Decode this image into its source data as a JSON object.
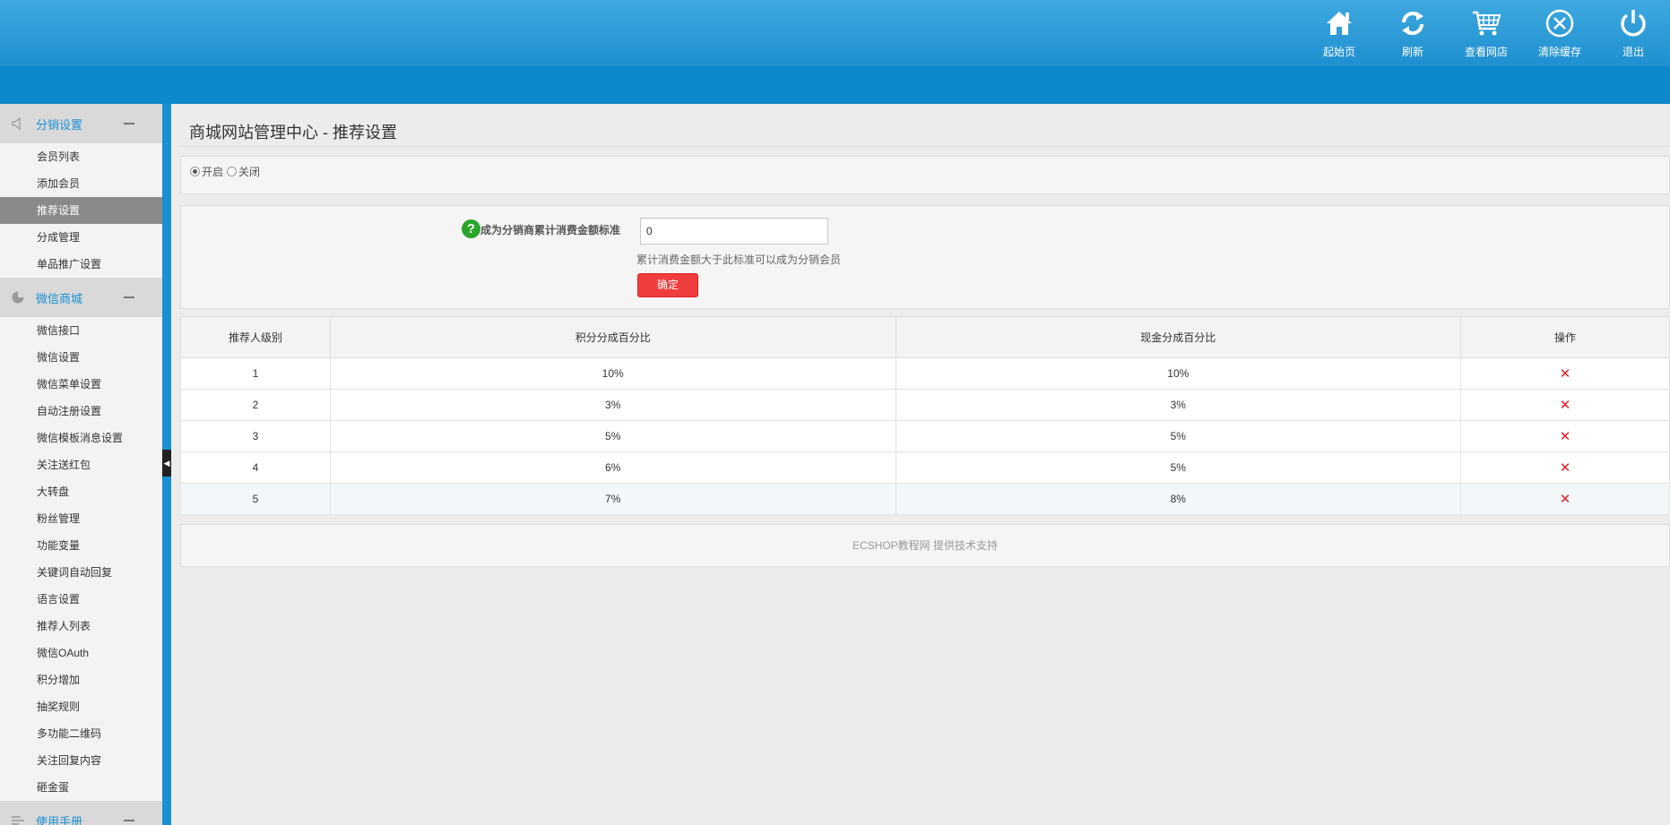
{
  "header": {
    "nav": [
      {
        "label": "起始页",
        "icon": "home-icon"
      },
      {
        "label": "刷新",
        "icon": "refresh-icon"
      },
      {
        "label": "查看网店",
        "icon": "cart-icon"
      },
      {
        "label": "清除缓存",
        "icon": "clear-cache-icon"
      },
      {
        "label": "退出",
        "icon": "power-icon"
      }
    ]
  },
  "sidebar": {
    "sections": [
      {
        "title": "分销设置",
        "icon": "speaker-icon",
        "items": [
          "会员列表",
          "添加会员",
          "推荐设置",
          "分成管理",
          "单品推广设置"
        ]
      },
      {
        "title": "微信商城",
        "icon": "pie-chart-icon",
        "items": [
          "微信接口",
          "微信设置",
          "微信菜单设置",
          "自动注册设置",
          "微信模板消息设置",
          "关注送红包",
          "大转盘",
          "粉丝管理",
          "功能变量",
          "关键词自动回复",
          "语言设置",
          "推荐人列表",
          "微信OAuth",
          "积分增加",
          "抽奖规则",
          "多功能二维码",
          "关注回复内容",
          "砸金蛋"
        ]
      },
      {
        "title": "使用手册",
        "icon": "list-icon",
        "items": []
      }
    ],
    "active_item": "推荐设置"
  },
  "main": {
    "title": "商城网站管理中心 - 推荐设置",
    "toggle": {
      "on_label": "开启",
      "off_label": "关闭",
      "selected": "开启"
    },
    "form": {
      "label": "成为分销商累计消费金额标准",
      "value": "0",
      "hint": "累计消费金额大于此标准可以成为分销会员",
      "submit_label": "确定"
    },
    "table": {
      "headers": [
        "推荐人级别",
        "积分分成百分比",
        "现金分成百分比",
        "操作"
      ],
      "rows": [
        [
          "1",
          "10%",
          "10%"
        ],
        [
          "2",
          "3%",
          "3%"
        ],
        [
          "3",
          "5%",
          "5%"
        ],
        [
          "4",
          "6%",
          "5%"
        ],
        [
          "5",
          "7%",
          "8%"
        ]
      ],
      "delete_symbol": "✕"
    },
    "footer": "ECSHOP教程网 提供技术支持"
  }
}
